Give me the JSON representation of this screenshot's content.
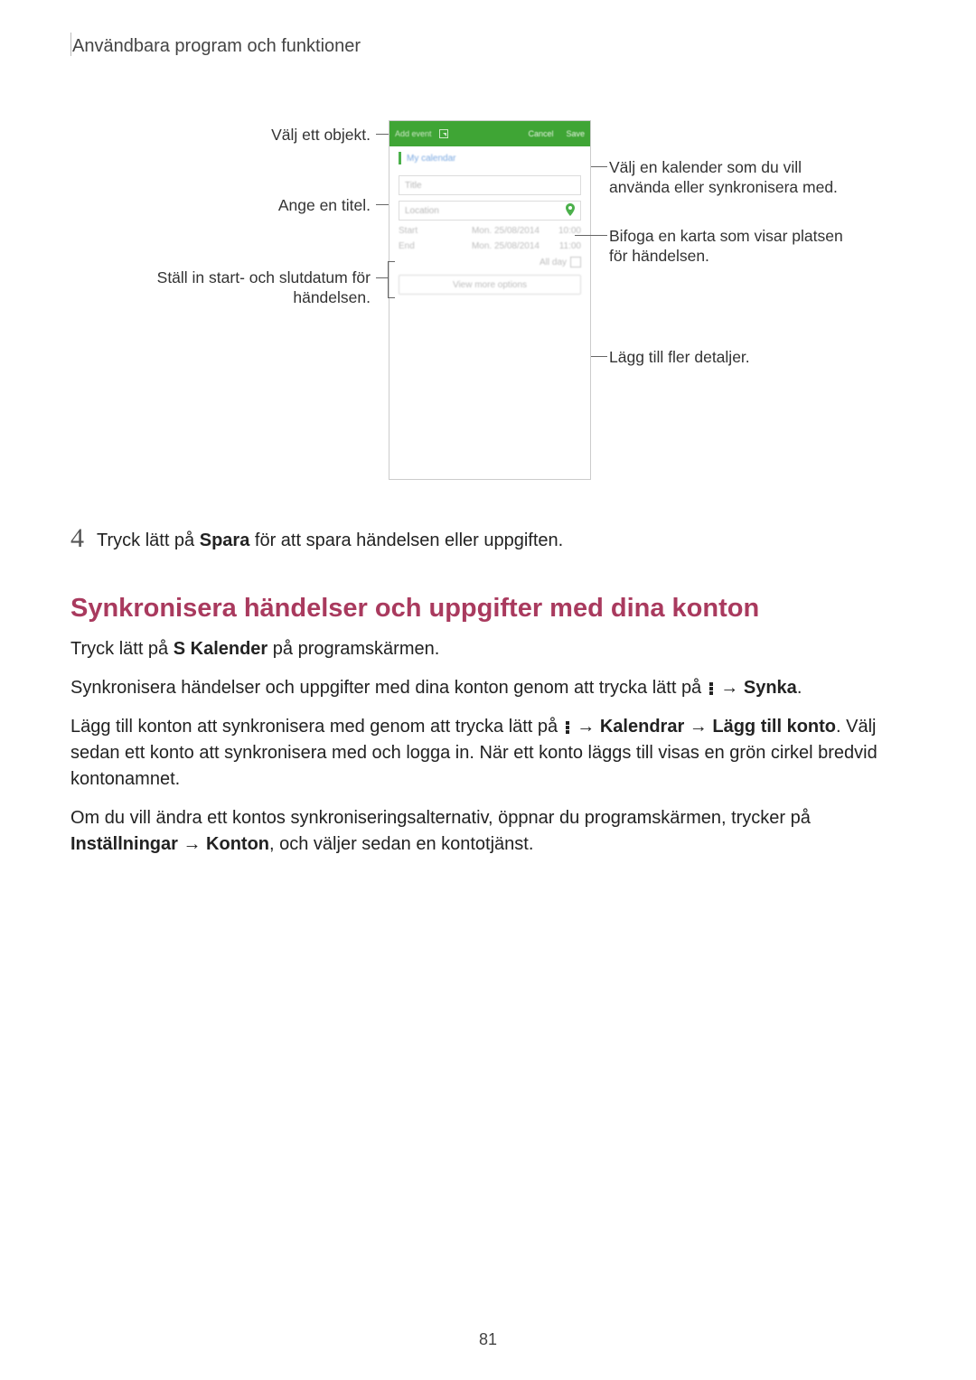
{
  "header": {
    "chapter": "Användbara program och funktioner"
  },
  "figure": {
    "callouts": {
      "select_object": "Välj ett objekt.",
      "enter_title": "Ange en titel.",
      "set_dates_1": "Ställ in start- och slutdatum för",
      "set_dates_2": "händelsen.",
      "choose_cal_1": "Välj en kalender som du vill",
      "choose_cal_2": "använda eller synkronisera med.",
      "attach_map_1": "Bifoga en karta som visar platsen",
      "attach_map_2": "för händelsen.",
      "add_details": "Lägg till fler detaljer."
    },
    "phone": {
      "add_event": "Add event",
      "cancel": "Cancel",
      "save": "Save",
      "my_calendar": "My calendar",
      "title_ph": "Title",
      "location_ph": "Location",
      "start_lbl": "Start",
      "end_lbl": "End",
      "start_dt": "Mon. 25/08/2014",
      "end_dt": "Mon. 25/08/2014",
      "start_tm": "10:00",
      "end_tm": "11:00",
      "all_day": "All day",
      "view_more": "View more options"
    }
  },
  "step4": {
    "num": "4",
    "pre": "Tryck lätt på ",
    "bold": "Spara",
    "post": " för att spara händelsen eller uppgiften."
  },
  "h2": "Synkronisera händelser och uppgifter med dina konton",
  "p1": {
    "pre": "Tryck lätt på ",
    "bold": "S Kalender",
    "post": " på programskärmen."
  },
  "p2": {
    "pre": "Synkronisera händelser och uppgifter med dina konton genom att trycka lätt på ",
    "arrow": " → ",
    "bold": "Synka",
    "post": "."
  },
  "p3": {
    "pre": "Lägg till konton att synkronisera med genom att trycka lätt på ",
    "arrow1": " → ",
    "bold1": "Kalendrar",
    "arrow2": " → ",
    "bold2": "Lägg till konto",
    "post1": ". ",
    "rest": "Välj sedan ett konto att synkronisera med och logga in. När ett konto läggs till visas en grön cirkel bredvid kontonamnet."
  },
  "p4": {
    "line1": "Om du vill ändra ett kontos synkroniseringsalternativ, öppnar du programskärmen, trycker på ",
    "bold1": "Inställningar",
    "arrow": " → ",
    "bold2": "Konton",
    "post": ", och väljer sedan en kontotjänst."
  },
  "page_number": "81"
}
